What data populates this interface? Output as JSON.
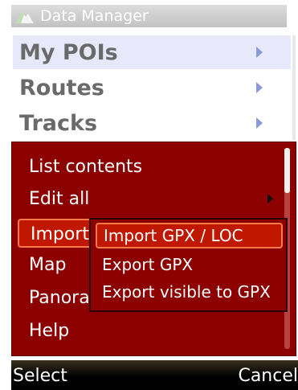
{
  "title": {
    "text": "Data Manager",
    "icon": "mountain-icon"
  },
  "list": {
    "items": [
      {
        "label": "My POIs",
        "selected": true
      },
      {
        "label": "Routes",
        "selected": false
      },
      {
        "label": "Tracks",
        "selected": false
      }
    ]
  },
  "menu": {
    "items": [
      {
        "label": "List contents"
      },
      {
        "label": "Edit all",
        "has_submenu": true
      },
      {
        "label": "Import",
        "active": true
      },
      {
        "label": "Map"
      },
      {
        "label": "Panorama"
      },
      {
        "label": "Help"
      }
    ]
  },
  "submenu": {
    "items": [
      {
        "label": "Import GPX / LOC",
        "active": true
      },
      {
        "label": "Export GPX"
      },
      {
        "label": "Export visible to GPX"
      }
    ]
  },
  "softkeys": {
    "left": "Select",
    "right": "Cancel"
  },
  "colors": {
    "menu_bg": "#8c0000",
    "highlight": "#c01800",
    "highlight_border": "#ff7a4a",
    "list_selected": "#e7e8fa"
  }
}
